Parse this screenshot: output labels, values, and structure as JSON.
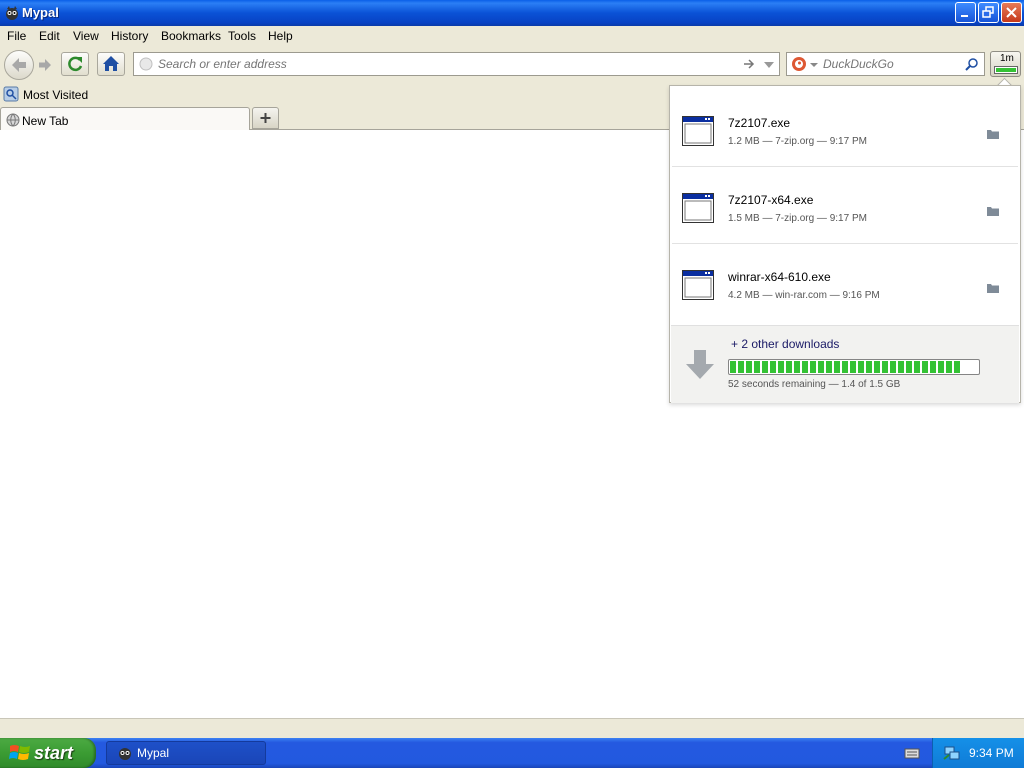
{
  "window": {
    "title": "Mypal"
  },
  "menu": [
    "File",
    "Edit",
    "View",
    "History",
    "Bookmarks",
    "Tools",
    "Help"
  ],
  "navbar": {
    "url_placeholder": "Search or enter address",
    "search_placeholder": "DuckDuckGo",
    "downloads_button_label": "1m"
  },
  "bookmarks": {
    "most_visited": "Most Visited"
  },
  "tabs": [
    {
      "label": "New Tab"
    }
  ],
  "downloads": {
    "items": [
      {
        "name": "7z2107.exe",
        "meta": "1.2 MB — 7-zip.org — 9:17 PM"
      },
      {
        "name": "7z2107-x64.exe",
        "meta": "1.5 MB — 7-zip.org — 9:17 PM"
      },
      {
        "name": "winrar-x64-610.exe",
        "meta": "4.2 MB — win-rar.com — 9:16 PM"
      }
    ],
    "summary": {
      "title": "+ 2 other downloads",
      "status": "52 seconds remaining — 1.4 of 1.5 GB",
      "progress": 0.93
    }
  },
  "taskbar": {
    "start_label": "start",
    "task_label": "Mypal",
    "clock": "9:34 PM"
  }
}
